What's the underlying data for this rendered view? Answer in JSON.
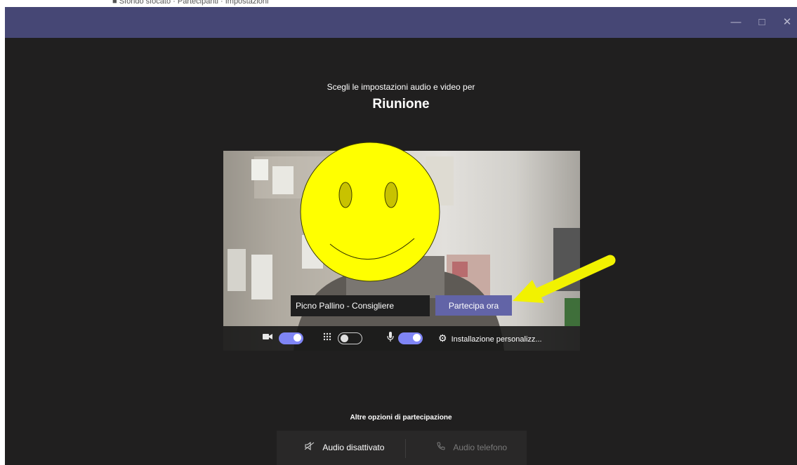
{
  "background_strip": [
    "Scegli le impostazioni audio e video per",
    "",
    ""
  ],
  "window": {
    "controls": {
      "minimize": "—",
      "maximize": "□",
      "close": "✕"
    }
  },
  "prejoin": {
    "subtitle": "Scegli le impostazioni audio e video per",
    "meeting_title": "Riunione",
    "name_value": "Picno Pallino - Consigliere",
    "join_label": "Partecipa ora",
    "toggles": {
      "camera": {
        "icon": "camera-icon",
        "on": true
      },
      "background_blur": {
        "icon": "background-blur-icon",
        "on": false
      },
      "microphone": {
        "icon": "microphone-icon",
        "on": true
      }
    },
    "custom_setup_label": "Installazione personalizz...",
    "other_options_label": "Altre opzioni di partecipazione",
    "audio_off_label": "Audio disattivato",
    "phone_audio_label": "Audio telefono"
  },
  "colors": {
    "titlebar": "#464775",
    "background": "#201f1f",
    "accent": "#6264a7",
    "toggle_on": "#7f85f5",
    "annotation_arrow": "#f2f200",
    "smiley_fill": "#ffff00"
  }
}
